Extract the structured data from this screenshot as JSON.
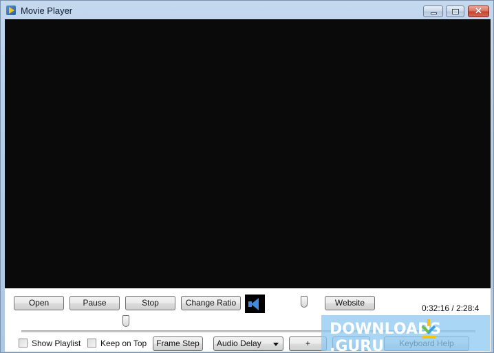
{
  "window": {
    "title": "Movie Player",
    "caption_buttons": {
      "minimize": "minimize",
      "maximize": "maximize",
      "close": "✕"
    }
  },
  "controls": {
    "open_label": "Open",
    "pause_label": "Pause",
    "stop_label": "Stop",
    "change_ratio_label": "Change Ratio",
    "website_label": "Website",
    "frame_step_label": "Frame Step",
    "plus_label": "+",
    "minus_label": "-",
    "keyboard_help_label": "Keyboard Help",
    "show_playlist_label": "Show Playlist",
    "keep_on_top_label": "Keep on Top",
    "show_playlist_checked": false,
    "keep_on_top_checked": false,
    "audio_delay_selected": "Audio Delay",
    "time_display": "0:32:16 /  2:28:4",
    "volume_level": 0.75,
    "seek_position": 0.23
  },
  "watermark": {
    "text_left": "DOWNLOADS",
    "text_right": ".GURU"
  }
}
